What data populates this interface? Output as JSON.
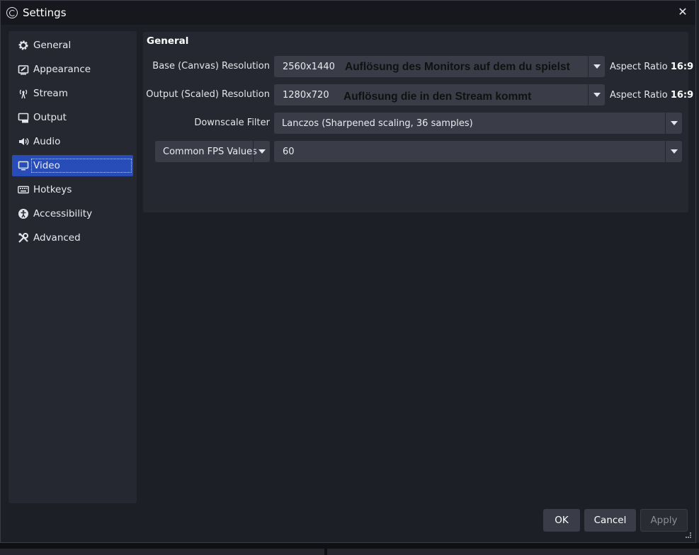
{
  "window": {
    "title": "Settings"
  },
  "sidebar": {
    "items": [
      {
        "label": "General",
        "icon": "gear-icon"
      },
      {
        "label": "Appearance",
        "icon": "appearance-icon"
      },
      {
        "label": "Stream",
        "icon": "antenna-icon"
      },
      {
        "label": "Output",
        "icon": "output-icon"
      },
      {
        "label": "Audio",
        "icon": "speaker-icon"
      },
      {
        "label": "Video",
        "icon": "monitor-icon",
        "active": true
      },
      {
        "label": "Hotkeys",
        "icon": "keyboard-icon"
      },
      {
        "label": "Accessibility",
        "icon": "accessibility-icon"
      },
      {
        "label": "Advanced",
        "icon": "tools-icon"
      }
    ]
  },
  "video": {
    "group_title": "General",
    "base_resolution": {
      "label": "Base (Canvas) Resolution",
      "value": "2560x1440",
      "annotation": "Auflösung des Monitors auf dem du spielst",
      "aspect_label": "Aspect Ratio",
      "aspect_value": "16:9"
    },
    "output_resolution": {
      "label": "Output (Scaled) Resolution",
      "value": "1280x720",
      "annotation": "Auflösung die in den Stream kommt",
      "aspect_label": "Aspect Ratio",
      "aspect_value": "16:9"
    },
    "downscale_filter": {
      "label": "Downscale Filter",
      "value": "Lanczos (Sharpened scaling, 36 samples)"
    },
    "fps": {
      "type_value": "Common FPS Values",
      "value": "60"
    }
  },
  "buttons": {
    "ok": "OK",
    "cancel": "Cancel",
    "apply": "Apply"
  },
  "colors": {
    "accent": "#284cb8",
    "panel": "#262831",
    "background": "#1d1f26",
    "input": "#3a3d48"
  }
}
